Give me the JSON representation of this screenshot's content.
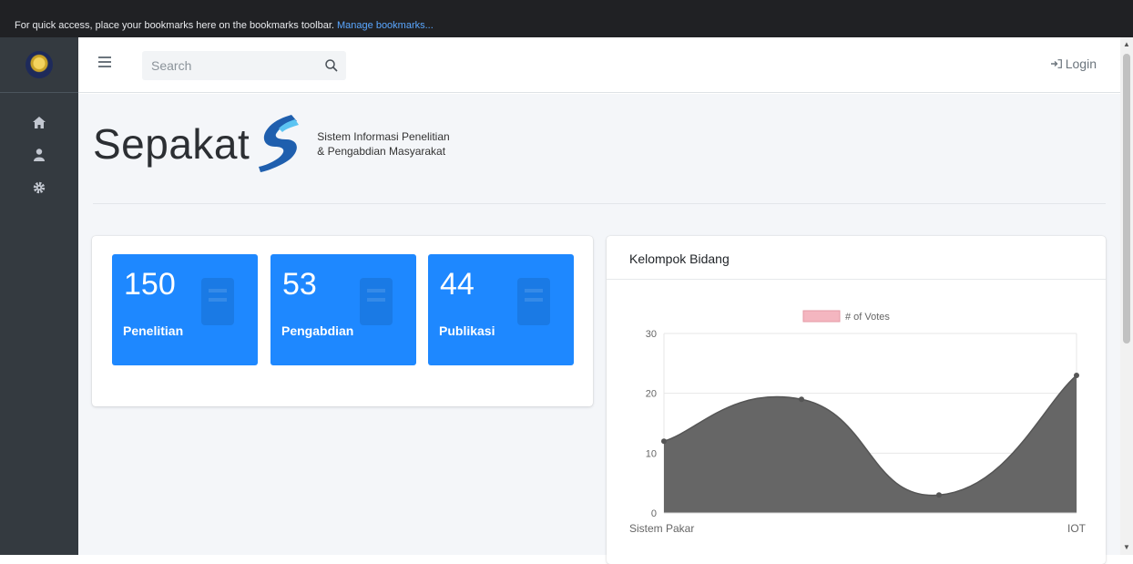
{
  "browser": {
    "bookmarks_text": "For quick access, place your bookmarks here on the bookmarks toolbar.",
    "bookmarks_link": "Manage bookmarks..."
  },
  "sidebar": {
    "items": [
      {
        "icon": "home-icon"
      },
      {
        "icon": "user-icon"
      },
      {
        "icon": "gear-icon"
      }
    ]
  },
  "topbar": {
    "search_placeholder": "Search",
    "login_label": "Login"
  },
  "brand": {
    "name": "Sepakat",
    "tagline_1": "Sistem Informasi Penelitian",
    "tagline_2": "& Pengabdian Masyarakat"
  },
  "stats": [
    {
      "value": "150",
      "label": "Penelitian"
    },
    {
      "value": "53",
      "label": "Pengabdian"
    },
    {
      "value": "44",
      "label": "Publikasi"
    }
  ],
  "colors": {
    "accent": "#1e88ff",
    "sidebar": "#343a40",
    "area_fill": "#666666",
    "legend_swatch": "#f4b6c0"
  },
  "chart": {
    "title": "Kelompok Bidang"
  },
  "chart_data": {
    "type": "area",
    "categories": [
      "Sistem Pakar",
      "",
      "",
      "IOT"
    ],
    "series": [
      {
        "name": "# of Votes",
        "values": [
          12,
          19,
          3,
          23
        ]
      }
    ],
    "ylim": [
      0,
      30
    ],
    "yticks": [
      "0",
      "10",
      "20",
      "30"
    ],
    "grid": true,
    "legend": "top-center"
  }
}
